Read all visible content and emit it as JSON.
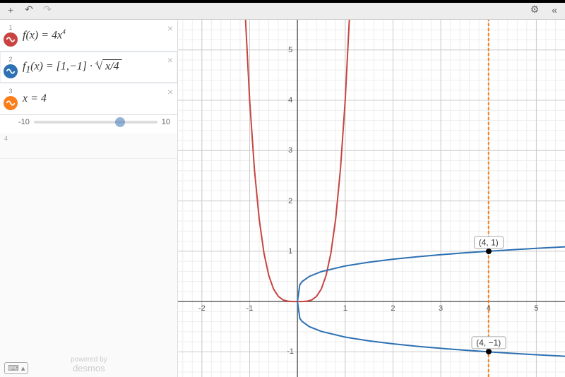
{
  "toolbar": {
    "undo": "↶",
    "redo": "↷",
    "settings": "⚙",
    "collapse": "«"
  },
  "expressions": [
    {
      "index": "1",
      "color": "#c74440",
      "formula_html": "f(x) = 4x<sup>4</sup>",
      "plain": "f(x) = 4x^4"
    },
    {
      "index": "2",
      "color": "#2d70b3",
      "formula_html": "f<sub>1</sub>(x) = [1,−1] · <span class='root-sym'><sup style='font-size:0.55em;margin-right:-3px;'>4</sup>√</span><span style='text-decoration:overline;'>&nbsp;x/4&nbsp;</span>",
      "plain": "f1(x) = [1,-1] * (x/4)^(1/4)"
    },
    {
      "index": "3",
      "color": "#fa7e19",
      "formula_html": "x = 4",
      "plain": "x = 4",
      "slider": {
        "min": "-10",
        "max": "10",
        "value": 4,
        "value_text": "4"
      }
    }
  ],
  "empty_index": "4",
  "branding_top": "powered by",
  "branding_name": "desmos",
  "chart_data": {
    "type": "line",
    "title": "",
    "xlabel": "",
    "ylabel": "",
    "xlim": [
      -2.5,
      5.6
    ],
    "ylim": [
      -1.5,
      5.6
    ],
    "x_ticks": [
      -2,
      -1,
      0,
      1,
      2,
      3,
      4,
      5
    ],
    "y_ticks": [
      -1,
      1,
      2,
      3,
      4,
      5
    ],
    "grid": true,
    "minor_grid": 5,
    "series": [
      {
        "name": "f(x)=4x^4",
        "color": "#c74440",
        "x": [
          -1.1,
          -1.0,
          -0.9,
          -0.8,
          -0.7,
          -0.6,
          -0.5,
          -0.4,
          -0.3,
          -0.2,
          -0.1,
          0,
          0.1,
          0.2,
          0.3,
          0.4,
          0.5,
          0.6,
          0.7,
          0.8,
          0.9,
          1.0,
          1.1
        ],
        "y": [
          5.8564,
          4.0,
          2.6244,
          1.6384,
          0.9604,
          0.5184,
          0.25,
          0.1024,
          0.0324,
          0.0064,
          0.0004,
          0,
          0.0004,
          0.0064,
          0.0324,
          0.1024,
          0.25,
          0.5184,
          0.9604,
          1.6384,
          2.6244,
          4.0,
          5.8564
        ]
      },
      {
        "name": "f1(x) upper = (x/4)^(1/4)",
        "color": "#2d70b3",
        "x": [
          0,
          0.05,
          0.1,
          0.25,
          0.5,
          1,
          1.5,
          2,
          2.5,
          3,
          3.5,
          4,
          4.5,
          5,
          5.6
        ],
        "y": [
          0,
          0.3344,
          0.3976,
          0.5,
          0.5946,
          0.7071,
          0.7825,
          0.8409,
          0.8891,
          0.9306,
          0.9672,
          1.0,
          1.0299,
          1.0574,
          1.0878
        ]
      },
      {
        "name": "f1(x) lower = -(x/4)^(1/4)",
        "color": "#2d70b3",
        "x": [
          0,
          0.05,
          0.1,
          0.25,
          0.5,
          1,
          1.5,
          2,
          2.5,
          3,
          3.5,
          4,
          4.5,
          5,
          5.6
        ],
        "y": [
          0,
          -0.3344,
          -0.3976,
          -0.5,
          -0.5946,
          -0.7071,
          -0.7825,
          -0.8409,
          -0.8891,
          -0.9306,
          -0.9672,
          -1.0,
          -1.0299,
          -1.0574,
          -1.0878
        ]
      },
      {
        "name": "x=4",
        "color": "#fa7e19",
        "dashed": true,
        "x": [
          4,
          4
        ],
        "y": [
          -1.5,
          5.6
        ]
      }
    ],
    "annotations": [
      {
        "x": 4,
        "y": 1,
        "text": "(4, 1)"
      },
      {
        "x": 4,
        "y": -1,
        "text": "(4, −1)"
      }
    ]
  }
}
